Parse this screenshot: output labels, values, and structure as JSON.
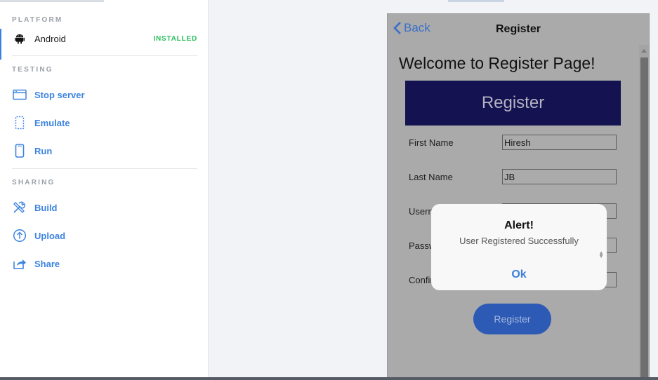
{
  "sidebar": {
    "platform_title": "PLATFORM",
    "platform": {
      "label": "Android",
      "badge": "INSTALLED",
      "icon": "android-icon"
    },
    "testing_title": "TESTING",
    "testing_items": [
      {
        "label": "Stop server",
        "icon": "browser-window-icon"
      },
      {
        "label": "Emulate",
        "icon": "dashed-device-icon"
      },
      {
        "label": "Run",
        "icon": "phone-icon"
      }
    ],
    "sharing_title": "SHARING",
    "sharing_items": [
      {
        "label": "Build",
        "icon": "tools-icon"
      },
      {
        "label": "Upload",
        "icon": "upload-circle-icon"
      },
      {
        "label": "Share",
        "icon": "share-icon"
      }
    ]
  },
  "device": {
    "nav": {
      "back_label": "Back",
      "title": "Register"
    },
    "welcome": "Welcome to Register Page!",
    "banner": "Register",
    "fields": [
      {
        "label": "First Name",
        "value": "Hiresh"
      },
      {
        "label": "Last Name",
        "value": "JB"
      },
      {
        "label": "Username",
        "value": ""
      },
      {
        "label": "Password",
        "value": ""
      },
      {
        "label": "Confirm Password",
        "value": ""
      }
    ],
    "register_button": "Register"
  },
  "alert": {
    "title": "Alert!",
    "message": "User Registered Successfully",
    "ok_label": "Ok"
  },
  "colors": {
    "accent_blue": "#3c83e0",
    "installed_green": "#2dbf5f",
    "banner_navy": "#141250",
    "button_blue": "#2c5ab5"
  }
}
